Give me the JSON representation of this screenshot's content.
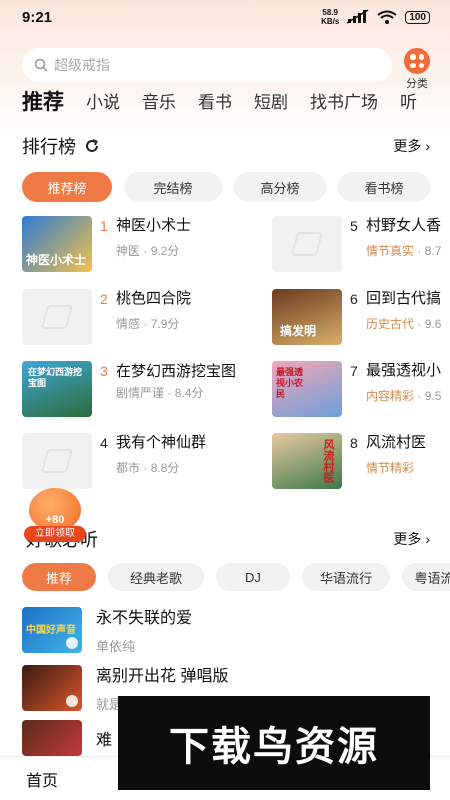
{
  "status": {
    "time": "9:21",
    "net_speed_value": "58.9",
    "net_speed_unit": "KB/s",
    "battery": "100"
  },
  "search": {
    "placeholder": "超级戒指"
  },
  "category": {
    "label": "分类"
  },
  "tabs": [
    "推荐",
    "小说",
    "音乐",
    "看书",
    "短剧",
    "找书广场",
    "听"
  ],
  "ranking": {
    "title": "排行榜",
    "more": "更多",
    "pills": [
      "推荐榜",
      "完结榜",
      "高分榜",
      "看书榜"
    ],
    "items": [
      {
        "num": "1",
        "title": "神医小术士",
        "tag": "神医",
        "score": "9.2分"
      },
      {
        "num": "2",
        "title": "桃色四合院",
        "tag": "情感",
        "score": "7.9分"
      },
      {
        "num": "3",
        "title": "在梦幻西游挖宝图",
        "tag": "剧情严谨",
        "score": "8.4分"
      },
      {
        "num": "4",
        "title": "我有个神仙群",
        "tag": "都市",
        "score": "8.8分"
      },
      {
        "num": "5",
        "title": "村野女人香",
        "tag": "情节真实",
        "score": "8.7"
      },
      {
        "num": "6",
        "title": "回到古代搞",
        "tag": "历史古代",
        "score": "9.6"
      },
      {
        "num": "7",
        "title": "最强透视小",
        "tag": "内容精彩",
        "score": "9.5"
      },
      {
        "num": "8",
        "title": "风流村医",
        "tag": "情节精彩",
        "score": ""
      }
    ],
    "cover_texts": {
      "c1": "神医小术士",
      "c3": "在梦幻西游挖宝图",
      "c6": "搞发明",
      "c7": "最强透视小农民",
      "c8": "风流村医"
    }
  },
  "reward": {
    "amount": "+80",
    "label": "立即领取"
  },
  "music": {
    "title": "好歌必听",
    "more": "更多",
    "pills": [
      "推荐",
      "经典老歌",
      "DJ",
      "华语流行",
      "粤语流"
    ],
    "songs": [
      {
        "title": "永不失联的爱",
        "artist": "单依纯",
        "cover_text": "中国好声音"
      },
      {
        "title": "离别开出花 弹唱版",
        "artist": "就是南方凯",
        "cover_text": ""
      },
      {
        "title": "难",
        "artist": "",
        "cover_text": ""
      }
    ]
  },
  "nav": {
    "home": "首页"
  },
  "watermark": {
    "text": "下载鸟资源"
  },
  "colors": {
    "accent": "#f07a45",
    "tag": "#d58a4a"
  }
}
